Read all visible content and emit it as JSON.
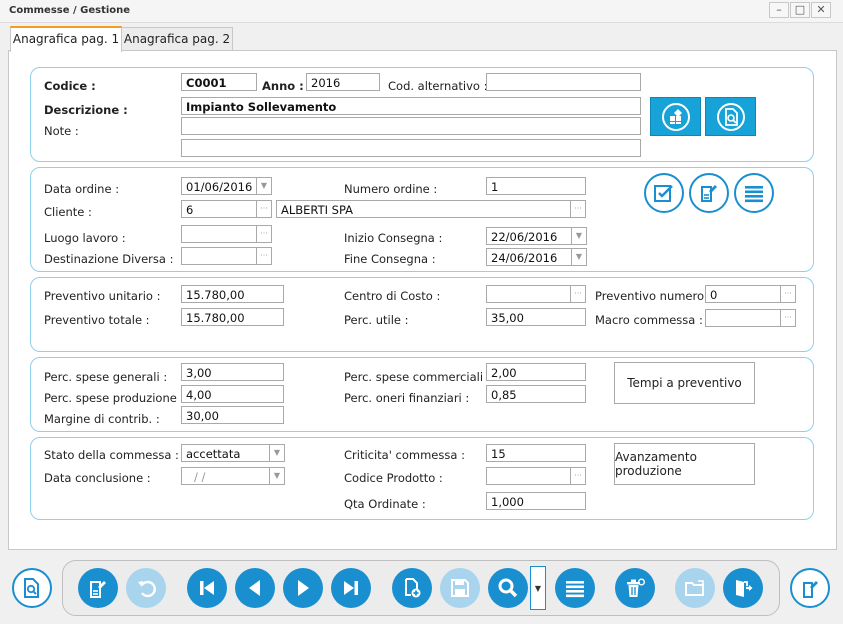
{
  "window": {
    "title": "Commesse / Gestione",
    "min": "–",
    "max": "□",
    "close": "✕"
  },
  "tabs": [
    {
      "label": "Anagrafica pag. 1"
    },
    {
      "label": "Anagrafica pag. 2"
    }
  ],
  "header": {
    "codice_label": "Codice :",
    "codice_value": "C0001",
    "anno_label": "Anno :",
    "anno_value": "2016",
    "cod_alt_label": "Cod. alternativo :",
    "cod_alt_value": "",
    "descrizione_label": "Descrizione :",
    "descrizione_value": "Impianto Sollevamento",
    "note_label": "Note :",
    "note_line1": "",
    "note_line2": ""
  },
  "order": {
    "data_ordine_label": "Data ordine :",
    "data_ordine_value": "01/06/2016",
    "numero_ordine_label": "Numero ordine :",
    "numero_ordine_value": "1",
    "cliente_label": "Cliente :",
    "cliente_code": "6",
    "cliente_name": "ALBERTI SPA",
    "luogo_label": "Luogo lavoro :",
    "luogo_value": "",
    "inizio_label": "Inizio Consegna :",
    "inizio_value": "22/06/2016",
    "dest_label": "Destinazione Diversa :",
    "dest_value": "",
    "fine_label": "Fine Consegna :",
    "fine_value": "24/06/2016"
  },
  "preventivo": {
    "unitario_label": "Preventivo unitario :",
    "unitario_value": "15.780,00",
    "centro_label": "Centro di Costo :",
    "centro_value": "",
    "numero_label": "Preventivo numero :",
    "numero_value": "0",
    "totale_label": "Preventivo totale :",
    "totale_value": "15.780,00",
    "utile_label": "Perc. utile :",
    "utile_value": "35,00",
    "macro_label": "Macro commessa :",
    "macro_value": ""
  },
  "spese": {
    "generali_label": "Perc. spese generali :",
    "generali_value": "3,00",
    "commerciali_label": "Perc. spese commerciali :",
    "commerciali_value": "2,00",
    "produzione_label": "Perc. spese produzione :",
    "produzione_value": "4,00",
    "oneri_label": "Perc. oneri finanziari :",
    "oneri_value": "0,85",
    "margine_label": "Margine di contrib. :",
    "margine_value": "30,00",
    "tempi_button": "Tempi a preventivo"
  },
  "stato": {
    "stato_label": "Stato della commessa :",
    "stato_value": "accettata",
    "criticita_label": "Criticita' commessa :",
    "criticita_value": "15",
    "conclusione_label": "Data conclusione :",
    "conclusione_value": "/ /",
    "prodotto_label": "Codice Prodotto :",
    "prodotto_value": "",
    "qta_label": "Qta Ordinate :",
    "qta_value": "1,000",
    "avanzamento_button": "Avanzamento produzione"
  },
  "colors": {
    "accent": "#1a8fd0",
    "group_border": "#8fd0ec",
    "tab_accent": "#f39c22",
    "square_button": "#17a2d8"
  }
}
